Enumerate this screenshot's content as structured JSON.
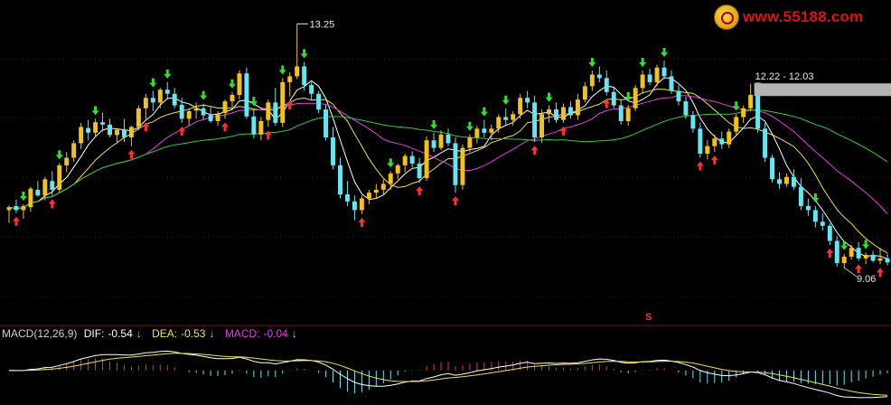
{
  "watermark": {
    "text": "www.55188.com"
  },
  "colors": {
    "background": "#000000",
    "up_candle": "#f2c21b",
    "down_candle": "#66e6f0",
    "ma_short": "#ffffff",
    "ma_mid": "#f2e14a",
    "ma_long_1": "#e040e0",
    "ma_long_2": "#33cc33",
    "buy_arrow": "#ff3030",
    "sell_arrow": "#33dd33",
    "grid": "#b02020",
    "macd_positive": "#ff3030",
    "macd_negative": "#66e6f0"
  },
  "marker_s": "S",
  "chart_data": {
    "type": "candlestick",
    "ylim": [
      8.3,
      13.6
    ],
    "annotations": {
      "high_label": "13.25",
      "high_value": 13.25,
      "mid_label": "12.22 - 12.03",
      "mid_value": 12.12,
      "low_label": "9.06",
      "low_value": 9.06
    },
    "candles": [
      [
        10.05,
        10.13,
        9.83,
        10.1
      ],
      [
        10.12,
        10.23,
        10.0,
        10.05
      ],
      [
        10.05,
        10.15,
        9.9,
        10.12
      ],
      [
        10.1,
        10.45,
        10.02,
        10.42
      ],
      [
        10.4,
        10.55,
        10.28,
        10.3
      ],
      [
        10.3,
        10.62,
        10.22,
        10.58
      ],
      [
        10.55,
        10.72,
        10.3,
        10.4
      ],
      [
        10.4,
        10.86,
        10.35,
        10.82
      ],
      [
        10.82,
        11.05,
        10.7,
        10.95
      ],
      [
        10.95,
        11.25,
        10.88,
        11.2
      ],
      [
        11.2,
        11.55,
        11.1,
        11.48
      ],
      [
        11.46,
        11.6,
        11.25,
        11.38
      ],
      [
        11.38,
        11.62,
        11.3,
        11.56
      ],
      [
        11.56,
        11.72,
        11.4,
        11.52
      ],
      [
        11.52,
        11.62,
        11.3,
        11.34
      ],
      [
        11.34,
        11.45,
        11.2,
        11.43
      ],
      [
        11.43,
        11.62,
        11.22,
        11.3
      ],
      [
        11.3,
        11.5,
        11.15,
        11.48
      ],
      [
        11.48,
        11.85,
        11.42,
        11.8
      ],
      [
        11.8,
        12.05,
        11.62,
        11.98
      ],
      [
        11.98,
        12.1,
        11.75,
        11.9
      ],
      [
        11.9,
        12.15,
        11.8,
        12.12
      ],
      [
        12.12,
        12.25,
        11.95,
        12.05
      ],
      [
        12.05,
        12.15,
        11.8,
        11.85
      ],
      [
        11.86,
        11.98,
        11.55,
        11.62
      ],
      [
        11.62,
        11.8,
        11.5,
        11.75
      ],
      [
        11.76,
        11.9,
        11.62,
        11.8
      ],
      [
        11.8,
        11.88,
        11.6,
        11.68
      ],
      [
        11.68,
        11.82,
        11.55,
        11.58
      ],
      [
        11.58,
        11.75,
        11.5,
        11.7
      ],
      [
        11.72,
        11.95,
        11.62,
        11.92
      ],
      [
        11.92,
        12.08,
        11.8,
        12.03
      ],
      [
        12.03,
        12.45,
        11.95,
        12.4
      ],
      [
        12.4,
        12.5,
        11.62,
        11.66
      ],
      [
        11.66,
        11.78,
        11.28,
        11.35
      ],
      [
        11.35,
        11.65,
        11.25,
        11.58
      ],
      [
        11.6,
        11.95,
        11.48,
        11.9
      ],
      [
        11.9,
        12.15,
        11.5,
        11.55
      ],
      [
        11.55,
        12.32,
        11.48,
        12.25
      ],
      [
        12.25,
        12.42,
        12.0,
        12.35
      ],
      [
        12.35,
        13.25,
        12.3,
        12.52
      ],
      [
        12.52,
        12.6,
        12.1,
        12.2
      ],
      [
        12.2,
        12.25,
        11.95,
        12.05
      ],
      [
        12.05,
        12.1,
        11.72,
        11.78
      ],
      [
        11.78,
        11.86,
        11.25,
        11.3
      ],
      [
        11.3,
        11.48,
        10.75,
        10.82
      ],
      [
        10.82,
        10.95,
        10.25,
        10.32
      ],
      [
        10.32,
        10.55,
        10.12,
        10.2
      ],
      [
        10.2,
        10.3,
        9.88,
        10.05
      ],
      [
        10.05,
        10.3,
        9.98,
        10.25
      ],
      [
        10.25,
        10.4,
        10.15,
        10.35
      ],
      [
        10.35,
        10.5,
        10.25,
        10.4
      ],
      [
        10.4,
        10.58,
        10.3,
        10.5
      ],
      [
        10.5,
        10.72,
        10.4,
        10.68
      ],
      [
        10.68,
        10.85,
        10.58,
        10.82
      ],
      [
        10.82,
        11.02,
        10.7,
        10.98
      ],
      [
        10.98,
        11.06,
        10.78,
        10.85
      ],
      [
        10.85,
        10.95,
        10.52,
        10.6
      ],
      [
        10.6,
        11.32,
        10.55,
        11.25
      ],
      [
        11.25,
        11.38,
        11.05,
        11.12
      ],
      [
        11.12,
        11.42,
        11.08,
        11.35
      ],
      [
        11.35,
        11.45,
        11.15,
        11.2
      ],
      [
        11.2,
        11.3,
        10.35,
        10.48
      ],
      [
        10.48,
        11.18,
        10.4,
        11.12
      ],
      [
        11.12,
        11.35,
        11.05,
        11.3
      ],
      [
        11.3,
        11.5,
        11.2,
        11.45
      ],
      [
        11.45,
        11.6,
        11.3,
        11.38
      ],
      [
        11.38,
        11.52,
        11.25,
        11.45
      ],
      [
        11.45,
        11.7,
        11.38,
        11.65
      ],
      [
        11.65,
        11.8,
        11.5,
        11.6
      ],
      [
        11.6,
        11.75,
        11.5,
        11.7
      ],
      [
        11.7,
        12.05,
        11.62,
        11.98
      ],
      [
        11.98,
        12.1,
        11.8,
        11.9
      ],
      [
        11.9,
        12.02,
        11.22,
        11.3
      ],
      [
        11.3,
        11.78,
        11.2,
        11.7
      ],
      [
        11.7,
        11.85,
        11.55,
        11.78
      ],
      [
        11.78,
        11.9,
        11.55,
        11.6
      ],
      [
        11.6,
        11.88,
        11.55,
        11.82
      ],
      [
        11.82,
        11.92,
        11.62,
        11.68
      ],
      [
        11.68,
        12.05,
        11.6,
        11.95
      ],
      [
        11.95,
        12.25,
        11.9,
        12.18
      ],
      [
        12.18,
        12.45,
        12.1,
        12.38
      ],
      [
        12.38,
        12.52,
        12.25,
        12.32
      ],
      [
        12.32,
        12.45,
        12.02,
        12.08
      ],
      [
        12.08,
        12.15,
        11.8,
        11.85
      ],
      [
        11.85,
        11.95,
        11.52,
        11.58
      ],
      [
        11.58,
        11.86,
        11.5,
        11.8
      ],
      [
        11.8,
        12.2,
        11.75,
        12.15
      ],
      [
        12.15,
        12.45,
        12.05,
        12.38
      ],
      [
        12.38,
        12.48,
        12.2,
        12.25
      ],
      [
        12.25,
        12.55,
        12.18,
        12.5
      ],
      [
        12.5,
        12.62,
        12.3,
        12.35
      ],
      [
        12.35,
        12.45,
        12.05,
        12.1
      ],
      [
        12.1,
        12.2,
        11.85,
        11.92
      ],
      [
        11.92,
        12.0,
        11.62,
        11.68
      ],
      [
        11.68,
        11.75,
        11.38,
        11.45
      ],
      [
        11.45,
        11.55,
        10.95,
        11.02
      ],
      [
        11.02,
        11.25,
        10.92,
        11.15
      ],
      [
        11.15,
        11.35,
        11.05,
        11.28
      ],
      [
        11.28,
        11.4,
        11.1,
        11.18
      ],
      [
        11.18,
        11.45,
        11.12,
        11.4
      ],
      [
        11.4,
        11.7,
        11.35,
        11.65
      ],
      [
        11.65,
        11.85,
        11.55,
        11.8
      ],
      [
        11.8,
        12.22,
        11.75,
        12.03
      ],
      [
        12.03,
        12.1,
        11.38,
        11.45
      ],
      [
        11.45,
        11.55,
        10.88,
        10.95
      ],
      [
        10.95,
        11.0,
        10.52,
        10.58
      ],
      [
        10.58,
        10.7,
        10.42,
        10.5
      ],
      [
        10.5,
        10.68,
        10.45,
        10.62
      ],
      [
        10.62,
        10.75,
        10.4,
        10.45
      ],
      [
        10.45,
        10.6,
        10.05,
        10.12
      ],
      [
        10.12,
        10.25,
        9.95,
        10.05
      ],
      [
        10.05,
        10.12,
        9.75,
        9.85
      ],
      [
        9.85,
        10.0,
        9.7,
        9.78
      ],
      [
        9.78,
        9.82,
        9.45,
        9.52
      ],
      [
        9.52,
        9.6,
        9.08,
        9.14
      ],
      [
        9.14,
        9.3,
        9.06,
        9.25
      ],
      [
        9.25,
        9.45,
        9.2,
        9.4
      ],
      [
        9.4,
        9.5,
        9.18,
        9.22
      ],
      [
        9.22,
        9.32,
        9.12,
        9.28
      ],
      [
        9.28,
        9.35,
        9.15,
        9.18
      ],
      [
        9.18,
        9.4,
        9.12,
        9.22
      ],
      [
        9.22,
        9.3,
        9.1,
        9.15
      ]
    ],
    "signals": [
      {
        "i": 1,
        "type": "buy"
      },
      {
        "i": 2,
        "type": "sell"
      },
      {
        "i": 6,
        "type": "buy"
      },
      {
        "i": 7,
        "type": "sell"
      },
      {
        "i": 12,
        "type": "sell"
      },
      {
        "i": 17,
        "type": "buy"
      },
      {
        "i": 19,
        "type": "buy"
      },
      {
        "i": 20,
        "type": "sell"
      },
      {
        "i": 22,
        "type": "sell"
      },
      {
        "i": 24,
        "type": "buy"
      },
      {
        "i": 27,
        "type": "sell"
      },
      {
        "i": 30,
        "type": "buy"
      },
      {
        "i": 31,
        "type": "sell"
      },
      {
        "i": 34,
        "type": "sell"
      },
      {
        "i": 36,
        "type": "buy"
      },
      {
        "i": 38,
        "type": "sell"
      },
      {
        "i": 39,
        "type": "buy"
      },
      {
        "i": 41,
        "type": "sell"
      },
      {
        "i": 49,
        "type": "buy"
      },
      {
        "i": 53,
        "type": "sell"
      },
      {
        "i": 57,
        "type": "buy"
      },
      {
        "i": 59,
        "type": "sell"
      },
      {
        "i": 62,
        "type": "buy"
      },
      {
        "i": 64,
        "type": "sell"
      },
      {
        "i": 66,
        "type": "sell"
      },
      {
        "i": 69,
        "type": "sell"
      },
      {
        "i": 73,
        "type": "buy"
      },
      {
        "i": 75,
        "type": "sell"
      },
      {
        "i": 77,
        "type": "buy"
      },
      {
        "i": 81,
        "type": "sell"
      },
      {
        "i": 83,
        "type": "buy"
      },
      {
        "i": 86,
        "type": "sell"
      },
      {
        "i": 88,
        "type": "sell"
      },
      {
        "i": 91,
        "type": "sell"
      },
      {
        "i": 96,
        "type": "buy"
      },
      {
        "i": 98,
        "type": "buy"
      },
      {
        "i": 101,
        "type": "sell"
      },
      {
        "i": 104,
        "type": "sell"
      },
      {
        "i": 112,
        "type": "sell"
      },
      {
        "i": 114,
        "type": "buy"
      },
      {
        "i": 116,
        "type": "sell"
      },
      {
        "i": 118,
        "type": "buy"
      },
      {
        "i": 119,
        "type": "sell"
      },
      {
        "i": 121,
        "type": "buy"
      },
      {
        "i": 124,
        "type": "sell"
      },
      {
        "i": 126,
        "type": "sell"
      }
    ],
    "ma_periods": [
      5,
      10,
      20,
      40
    ],
    "macd": {
      "label": "MACD(12,26,9)",
      "dif_label": "DIF:",
      "dif_value": "-0.54",
      "dea_label": "DEA:",
      "dea_value": "-0.53",
      "macd_label": "MACD:",
      "macd_value": "-0.04",
      "arrow": "↓",
      "ylim": [
        -0.7,
        0.65
      ]
    }
  }
}
